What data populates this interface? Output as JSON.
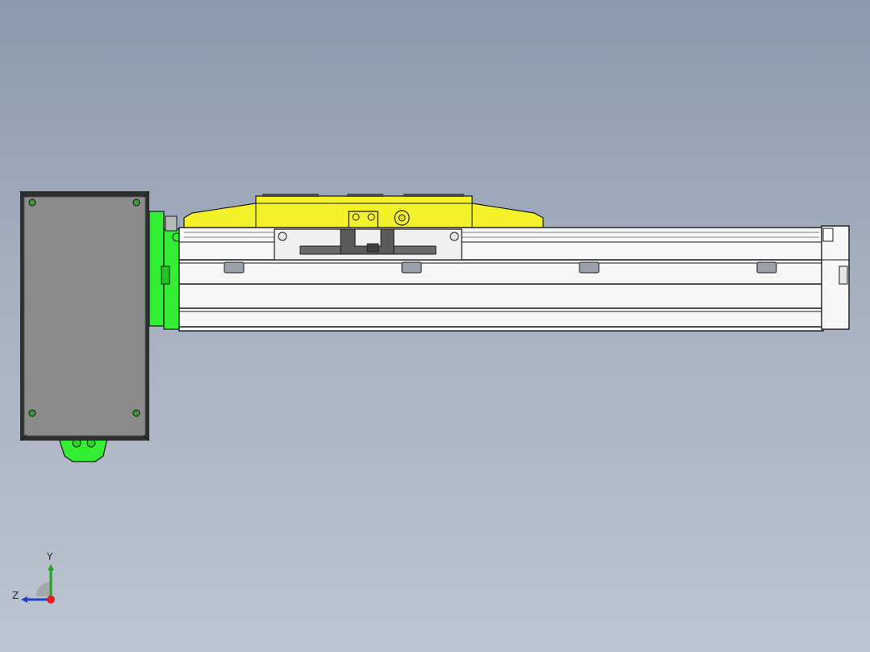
{
  "colors": {
    "background_top": "#8a9aae",
    "background_bottom": "#bdc4d1",
    "motor_body": "#8b8b8b",
    "motor_edge": "#2f2f2f",
    "adapter_green": "#33ee33",
    "carriage_yellow": "#f3f12a",
    "rail_white": "#f7f7f7",
    "outline": "#1a1a1a",
    "axis_y": "#1fa51f",
    "axis_z": "#1f3fd0",
    "axis_origin": "#e81e1e"
  },
  "triad": {
    "y_label": "Y",
    "z_label": "Z"
  },
  "icons": {
    "view_triad": "coordinate-triad-icon"
  }
}
